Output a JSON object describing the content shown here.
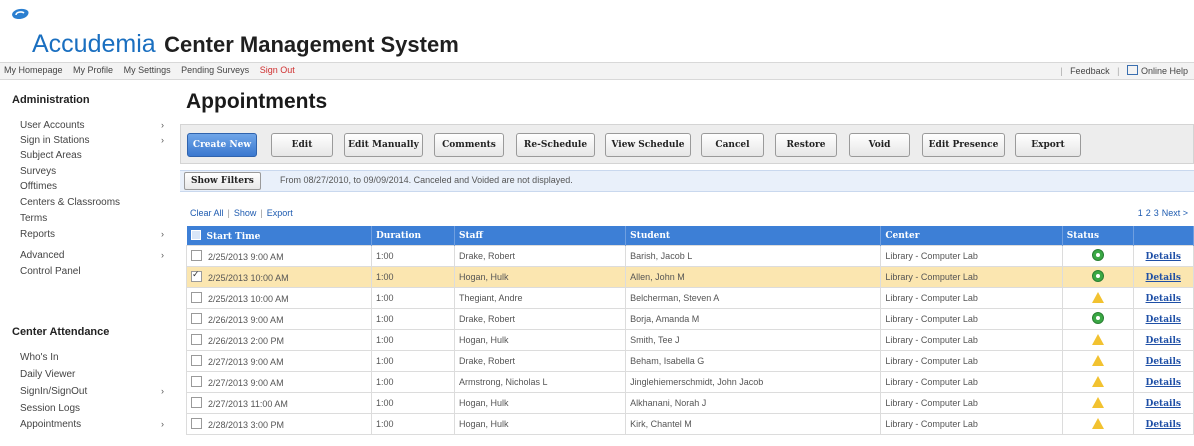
{
  "brand": {
    "name_blue": "Accudemia",
    "name_dark": "Center Management System"
  },
  "topnav": {
    "links": [
      "My Homepage",
      "My Profile",
      "My Settings",
      "Pending Surveys",
      "Sign Out"
    ],
    "feedback": "Feedback",
    "help": "Online Help"
  },
  "sidebar": {
    "admin_heading": "Administration",
    "admin_items": [
      {
        "label": "User Accounts",
        "arrow": "›"
      },
      {
        "label": "Sign in Stations",
        "arrow": "›"
      },
      {
        "label": "Subject Areas",
        "arrow": ""
      },
      {
        "label": "Surveys",
        "arrow": ""
      },
      {
        "label": "Offtimes",
        "arrow": ""
      },
      {
        "label": "Centers & Classrooms",
        "arrow": ""
      },
      {
        "label": "Terms",
        "arrow": ""
      },
      {
        "label": "Reports",
        "arrow": "›"
      },
      {
        "label": "Advanced",
        "arrow": "›"
      },
      {
        "label": "Control Panel",
        "arrow": ""
      }
    ],
    "attendance_heading": "Center Attendance",
    "attendance_items": [
      {
        "label": "Who's In",
        "arrow": ""
      },
      {
        "label": "Daily Viewer",
        "arrow": ""
      },
      {
        "label": "SignIn/SignOut",
        "arrow": "›"
      },
      {
        "label": "Session Logs",
        "arrow": ""
      },
      {
        "label": "Appointments",
        "arrow": "›"
      }
    ]
  },
  "page_title": "Appointments",
  "toolbar": {
    "buttons": [
      "Create New",
      "Edit",
      "Edit Manually",
      "Comments",
      "Re-Schedule",
      "View Schedule",
      "Cancel",
      "Restore",
      "Void",
      "Edit Presence",
      "Export"
    ]
  },
  "filter": {
    "button": "Show Filters",
    "text": "From 08/27/2010, to 09/09/2014. Canceled and Voided are not displayed."
  },
  "links": {
    "clear_all": "Clear All",
    "show": "Show",
    "export": "Export"
  },
  "pager": {
    "pages": [
      "1",
      "2",
      "3"
    ],
    "next": "Next >"
  },
  "table": {
    "columns": [
      "Start Time",
      "Duration",
      "Staff",
      "Student",
      "Center",
      "Status",
      ""
    ],
    "rows": [
      {
        "start": "2/25/2013 9:00 AM",
        "duration": "1:00",
        "staff": "Drake, Robert",
        "student": "Barish, Jacob L",
        "center": "Library - Computer Lab",
        "status": "ok",
        "details": "Details",
        "checked": false,
        "selected": false
      },
      {
        "start": "2/25/2013 10:00 AM",
        "duration": "1:00",
        "staff": "Hogan, Hulk",
        "student": "Allen, John M",
        "center": "Library - Computer Lab",
        "status": "ok",
        "details": "Details",
        "checked": true,
        "selected": true
      },
      {
        "start": "2/25/2013 10:00 AM",
        "duration": "1:00",
        "staff": "Thegiant, Andre",
        "student": "Belcherman, Steven A",
        "center": "Library - Computer Lab",
        "status": "warn",
        "details": "Details",
        "checked": false,
        "selected": false
      },
      {
        "start": "2/26/2013 9:00 AM",
        "duration": "1:00",
        "staff": "Drake, Robert",
        "student": "Borja, Amanda M",
        "center": "Library - Computer Lab",
        "status": "ok",
        "details": "Details",
        "checked": false,
        "selected": false
      },
      {
        "start": "2/26/2013 2:00 PM",
        "duration": "1:00",
        "staff": "Hogan, Hulk",
        "student": "Smith, Tee J",
        "center": "Library - Computer Lab",
        "status": "warn",
        "details": "Details",
        "checked": false,
        "selected": false
      },
      {
        "start": "2/27/2013 9:00 AM",
        "duration": "1:00",
        "staff": "Drake, Robert",
        "student": "Beham, Isabella G",
        "center": "Library - Computer Lab",
        "status": "warn",
        "details": "Details",
        "checked": false,
        "selected": false
      },
      {
        "start": "2/27/2013 9:00 AM",
        "duration": "1:00",
        "staff": "Armstrong, Nicholas L",
        "student": "Jinglehiemerschmidt, John Jacob",
        "center": "Library - Computer Lab",
        "status": "warn",
        "details": "Details",
        "checked": false,
        "selected": false
      },
      {
        "start": "2/27/2013 11:00 AM",
        "duration": "1:00",
        "staff": "Hogan, Hulk",
        "student": "Alkhanani, Norah J",
        "center": "Library - Computer Lab",
        "status": "warn",
        "details": "Details",
        "checked": false,
        "selected": false
      },
      {
        "start": "2/28/2013 3:00 PM",
        "duration": "1:00",
        "staff": "Hogan, Hulk",
        "student": "Kirk, Chantel M",
        "center": "Library - Computer Lab",
        "status": "warn",
        "details": "Details",
        "checked": false,
        "selected": false
      }
    ]
  },
  "colors": {
    "brand_blue": "#1a6fc0",
    "header_blue": "#3d7fd6",
    "selected_row": "#fbe6b0",
    "status_ok": "#3aa844",
    "status_warn": "#f2c230"
  },
  "icons": {
    "logo": "accudemia-logo-icon",
    "help": "help-book-icon",
    "status_ok": "status-ok-icon",
    "status_warn": "warning-icon"
  }
}
